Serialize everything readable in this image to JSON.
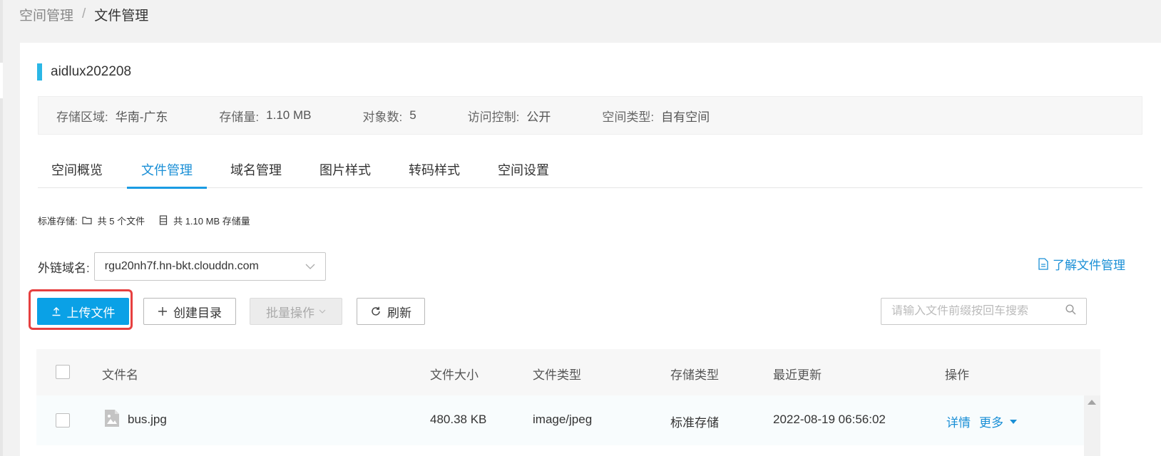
{
  "breadcrumb": {
    "parent": "空间管理",
    "separator": "/",
    "current": "文件管理"
  },
  "bucket": {
    "name": "aidlux202208"
  },
  "info": {
    "region_label": "存储区域:",
    "region_value": "华南-广东",
    "storage_label": "存储量:",
    "storage_value": "1.10 MB",
    "objects_label": "对象数:",
    "objects_value": "5",
    "access_label": "访问控制:",
    "access_value": "公开",
    "type_label": "空间类型:",
    "type_value": "自有空间"
  },
  "tabs": [
    {
      "label": "空间概览"
    },
    {
      "label": "文件管理"
    },
    {
      "label": "域名管理"
    },
    {
      "label": "图片样式"
    },
    {
      "label": "转码样式"
    },
    {
      "label": "空间设置"
    }
  ],
  "active_tab": "文件管理",
  "summary": {
    "label": "标准存储:",
    "files": "共 5 个文件",
    "size": "共 1.10 MB 存储量"
  },
  "domain": {
    "label": "外链域名:",
    "value": "rgu20nh7f.hn-bkt.clouddn.com"
  },
  "doc_link": "了解文件管理",
  "toolbar": {
    "upload": "上传文件",
    "mkdir": "创建目录",
    "batch": "批量操作",
    "refresh": "刷新",
    "search_placeholder": "请输入文件前缀按回车搜索"
  },
  "table": {
    "headers": [
      "文件名",
      "文件大小",
      "文件类型",
      "存储类型",
      "最近更新",
      "操作"
    ],
    "rows": [
      {
        "name": "bus.jpg",
        "size": "480.38 KB",
        "type": "image/jpeg",
        "storage": "标准存储",
        "updated": "2022-08-19 06:56:02",
        "detail": "详情",
        "more": "更多"
      }
    ]
  },
  "colors": {
    "accent": "#0aa1e6",
    "link": "#1a8fd6",
    "highlight": "#e64040",
    "title_bar": "#2bb7e6"
  },
  "icons": [
    "folder-icon",
    "file-list-icon",
    "chevron-down-icon",
    "document-icon",
    "upload-icon",
    "plus-icon",
    "refresh-icon",
    "search-icon",
    "image-file-icon",
    "caret-down-icon",
    "scroll-up-arrow-icon"
  ]
}
